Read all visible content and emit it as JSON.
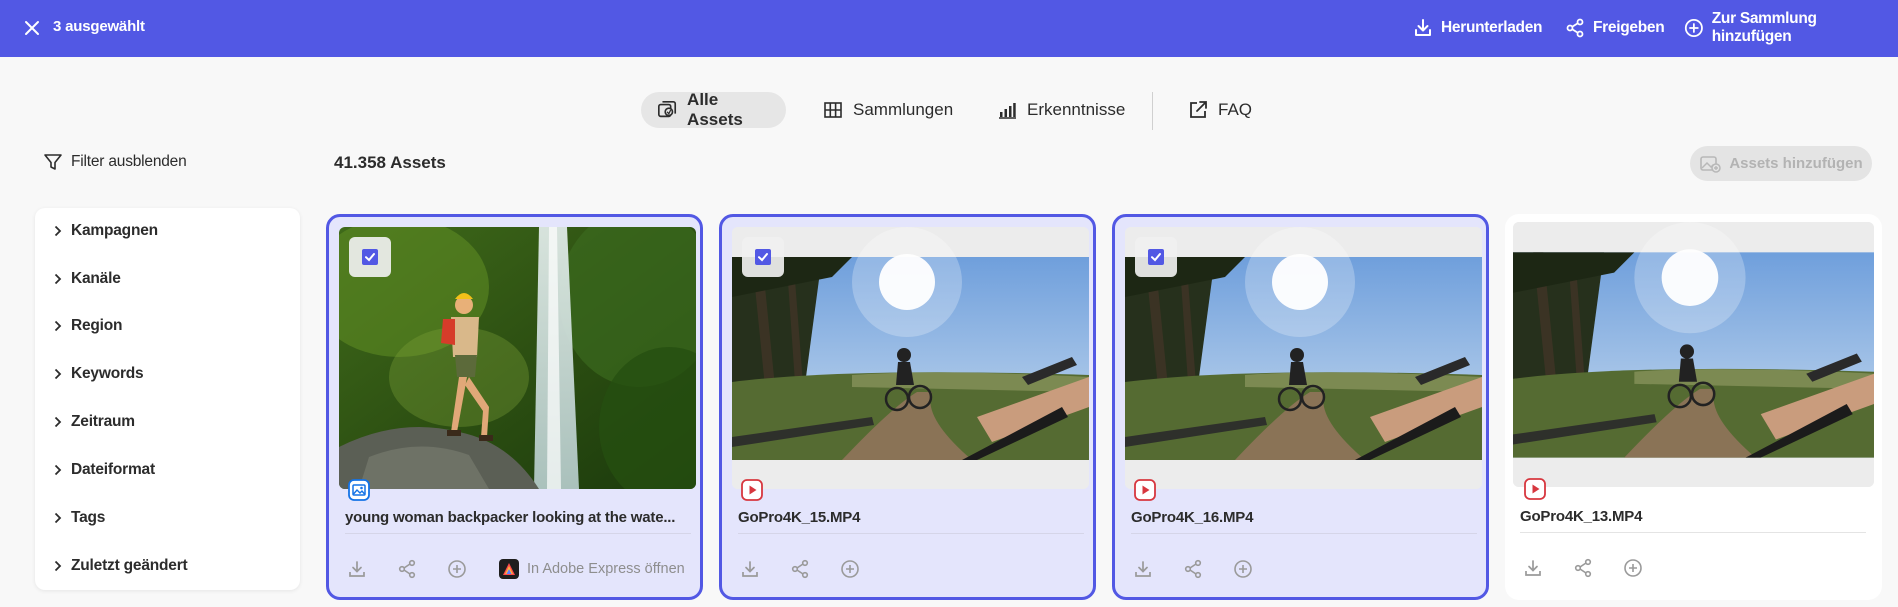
{
  "header": {
    "selected_label": "3 ausgewählt",
    "actions": {
      "download": "Herunterladen",
      "share": "Freigeben",
      "add_to_collection": "Zur Sammlung hinzufügen"
    }
  },
  "tabs": [
    {
      "label": "Alle Assets",
      "active": true
    },
    {
      "label": "Sammlungen",
      "active": false
    },
    {
      "label": "Erkenntnisse",
      "active": false
    },
    {
      "label": "FAQ",
      "active": false
    }
  ],
  "toolbar": {
    "filter_toggle_label": "Filter ausblenden",
    "asset_count": "41.358 Assets",
    "add_assets_label": "Assets hinzufügen"
  },
  "filters": [
    {
      "label": "Kampagnen"
    },
    {
      "label": "Kanäle"
    },
    {
      "label": "Region"
    },
    {
      "label": "Keywords"
    },
    {
      "label": "Zeitraum"
    },
    {
      "label": "Dateiformat"
    },
    {
      "label": "Tags"
    },
    {
      "label": "Zuletzt geändert"
    }
  ],
  "cards": [
    {
      "title": "young woman backpacker looking at the wate...",
      "type": "image",
      "selected": true,
      "express_label": "In Adobe Express öffnen"
    },
    {
      "title": "GoPro4K_15.MP4",
      "type": "video",
      "selected": true
    },
    {
      "title": "GoPro4K_16.MP4",
      "type": "video",
      "selected": true
    },
    {
      "title": "GoPro4K_13.MP4",
      "type": "video",
      "selected": false
    }
  ],
  "colors": {
    "accent": "#5258e4",
    "video_badge": "#d7373f",
    "image_badge": "#1473e6"
  }
}
